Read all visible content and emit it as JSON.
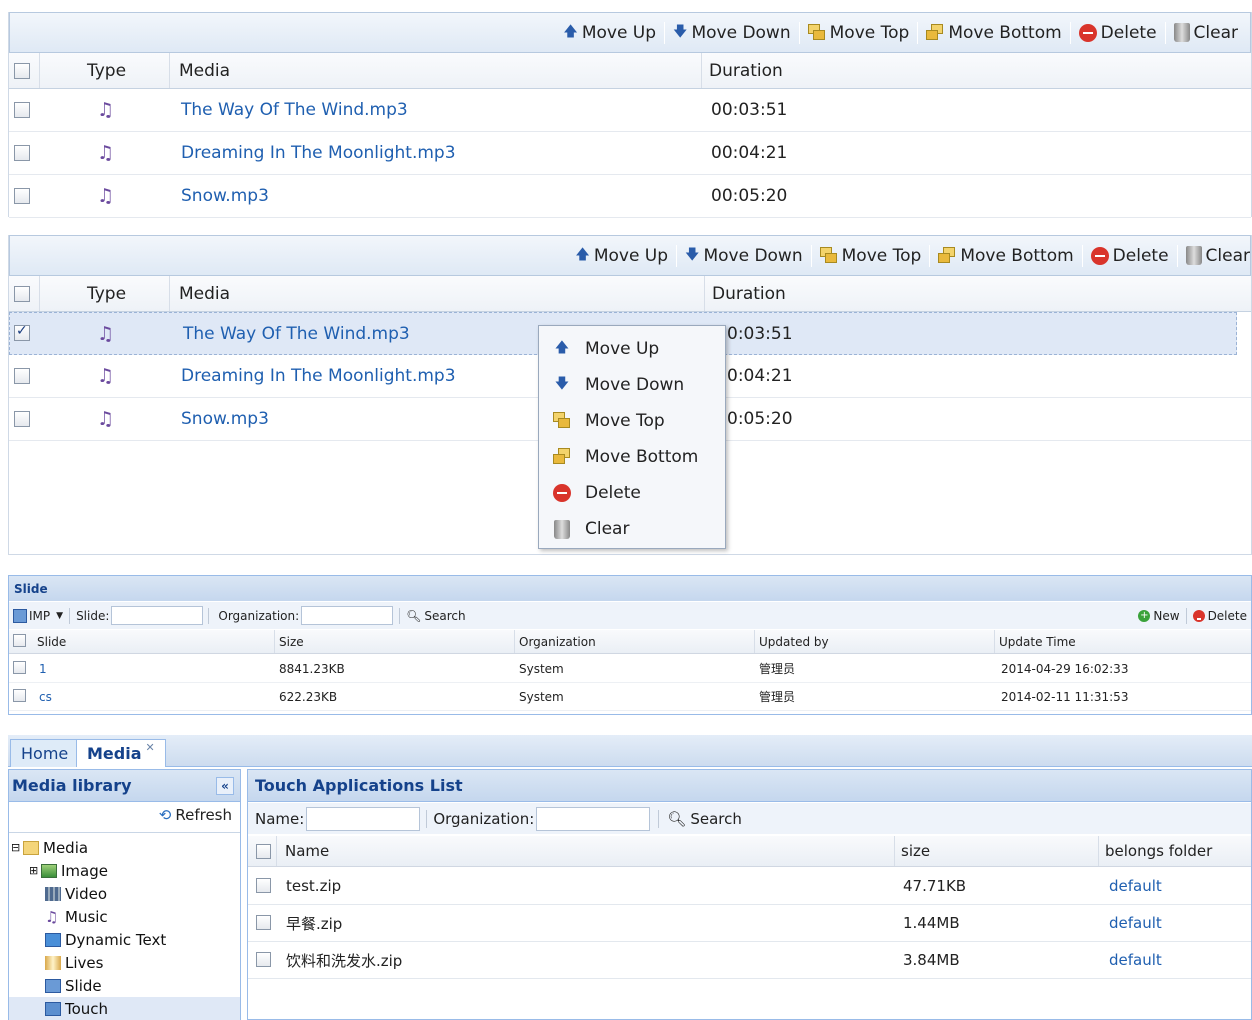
{
  "toolbar": {
    "move_up": "Move Up",
    "move_down": "Move Down",
    "move_top": "Move Top",
    "move_bottom": "Move Bottom",
    "delete": "Delete",
    "clear": "Clear"
  },
  "playlist": {
    "columns": {
      "type": "Type",
      "media": "Media",
      "duration": "Duration"
    },
    "rows": [
      {
        "name": "The Way Of The Wind.mp3",
        "duration": "00:03:51"
      },
      {
        "name": "Dreaming In The Moonlight.mp3",
        "duration": "00:04:21"
      },
      {
        "name": "Snow.mp3",
        "duration": "00:05:20"
      }
    ],
    "panel2_durations": [
      "0:03:51",
      "0:04:21",
      "0:05:20"
    ]
  },
  "context_menu": {
    "move_up": "Move Up",
    "move_down": "Move Down",
    "move_top": "Move Top",
    "move_bottom": "Move Bottom",
    "delete": "Delete",
    "clear": "Clear"
  },
  "slide_grid": {
    "title": "Slide",
    "imp": "IMP",
    "slide_label": "Slide:",
    "org_label": "Organization:",
    "search": "Search",
    "new": "New",
    "delete": "Delete",
    "columns": {
      "slide": "Slide",
      "size": "Size",
      "org": "Organization",
      "updated_by": "Updated by",
      "update_time": "Update Time"
    },
    "rows": [
      {
        "slide": "1",
        "size": "8841.23KB",
        "org": "System",
        "updated_by": "管理员",
        "time": "2014-04-29 16:02:33"
      },
      {
        "slide": "cs",
        "size": "622.23KB",
        "org": "System",
        "updated_by": "管理员",
        "time": "2014-02-11 11:31:53"
      }
    ]
  },
  "tabs": {
    "home": "Home",
    "media": "Media"
  },
  "library": {
    "title": "Media library",
    "refresh": "Refresh",
    "tree": [
      "Media",
      "Image",
      "Video",
      "Music",
      "Dynamic Text",
      "Lives",
      "Slide",
      "Touch"
    ]
  },
  "touch": {
    "title": "Touch Applications List",
    "name_label": "Name:",
    "org_label": "Organization:",
    "search": "Search",
    "columns": {
      "name": "Name",
      "size": "size",
      "folder": "belongs folder"
    },
    "rows": [
      {
        "name": "test.zip",
        "size": "47.71KB",
        "folder": "default"
      },
      {
        "name": "早餐.zip",
        "size": "1.44MB",
        "folder": "default"
      },
      {
        "name": "饮料和洗发水.zip",
        "size": "3.84MB",
        "folder": "default"
      }
    ]
  }
}
